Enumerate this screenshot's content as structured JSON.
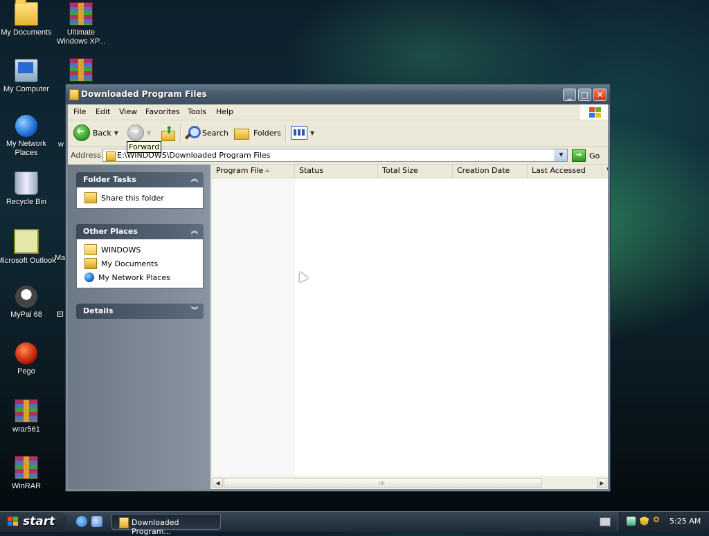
{
  "desktop": {
    "icons": [
      {
        "label": "My Documents",
        "icon": "my-documents-folder-icon"
      },
      {
        "label": "Ultimate Windows XP...",
        "icon": "winrar-archive-icon"
      },
      {
        "label": "My Computer",
        "icon": "my-computer-icon"
      },
      {
        "label": "My Network Places",
        "icon": "network-places-icon"
      },
      {
        "label": "Recycle Bin",
        "icon": "recycle-bin-icon"
      },
      {
        "label": "Microsoft Outlook",
        "icon": "outlook-icon"
      },
      {
        "label": "MyPal 68",
        "icon": "mypal-browser-icon"
      },
      {
        "label": "Pego",
        "icon": "pego-icon"
      },
      {
        "label": "wrar561",
        "icon": "winrar-archive-icon"
      },
      {
        "label": "WinRAR",
        "icon": "winrar-app-icon"
      }
    ],
    "partial_labels": [
      "w",
      "Ma",
      "El"
    ]
  },
  "window": {
    "title": "Downloaded Program Files",
    "menu": [
      "File",
      "Edit",
      "View",
      "Favorites",
      "Tools",
      "Help"
    ],
    "toolbar": {
      "back_label": "Back",
      "search_label": "Search",
      "folders_label": "Folders"
    },
    "tooltip": "Forward",
    "address": {
      "label": "Address",
      "value": "E:\\WINDOWS\\Downloaded Program Files",
      "go_label": "Go"
    },
    "task_pane": {
      "folder_tasks": {
        "title": "Folder Tasks",
        "items": [
          "Share this folder"
        ]
      },
      "other_places": {
        "title": "Other Places",
        "items": [
          "WINDOWS",
          "My Documents",
          "My Network Places"
        ]
      },
      "details": {
        "title": "Details"
      }
    },
    "columns": [
      "Program File",
      "Status",
      "Total Size",
      "Creation Date",
      "Last Accessed",
      "V"
    ],
    "sorted_column": "Program File"
  },
  "taskbar": {
    "start_label": "start",
    "task_item": "Downloaded Program...",
    "clock": "5:25 AM"
  }
}
